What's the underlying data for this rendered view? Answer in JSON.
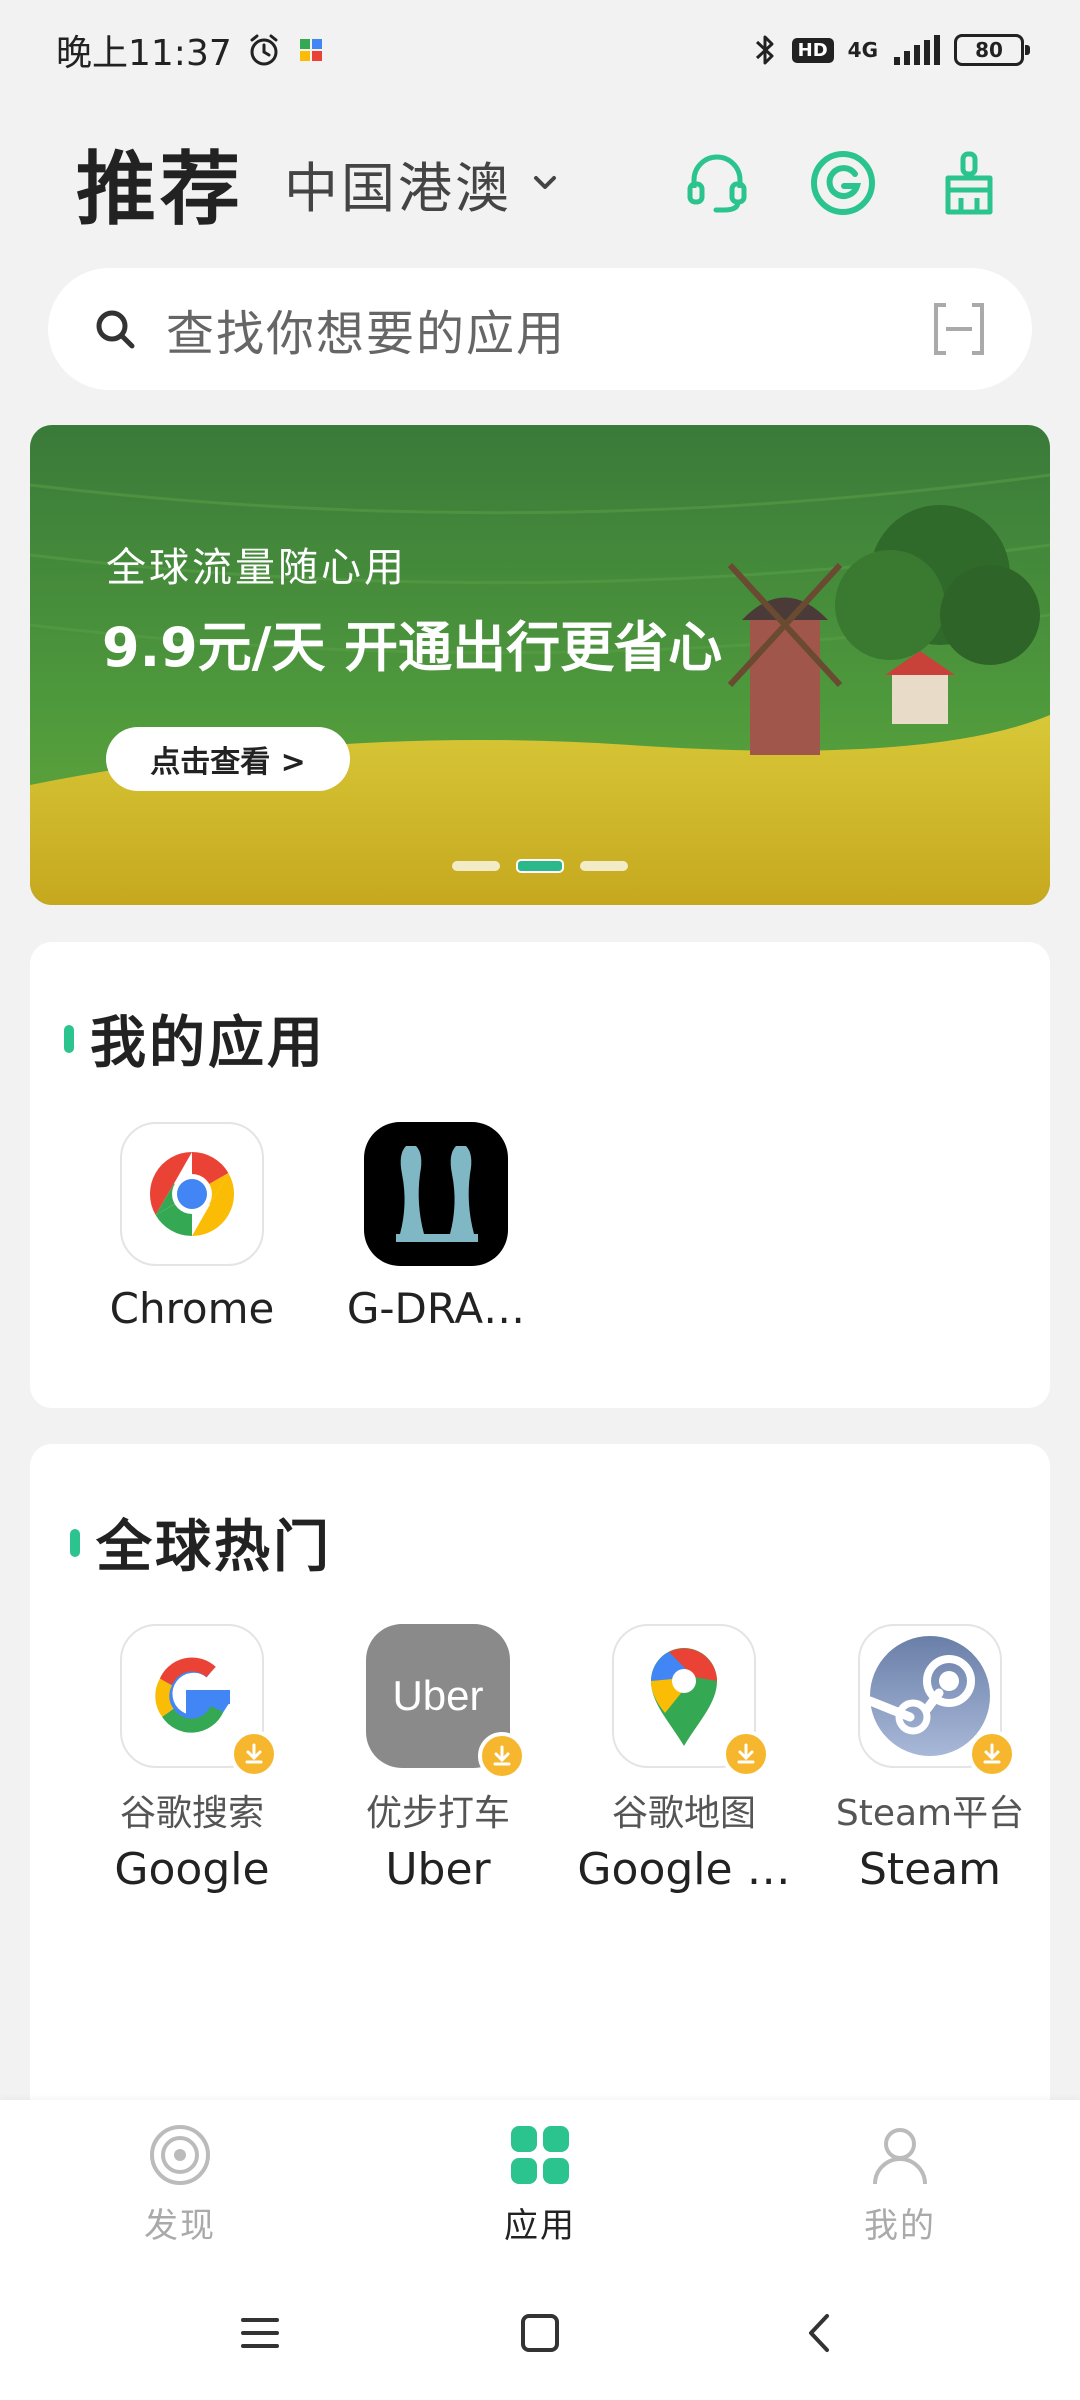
{
  "status_bar": {
    "time": "晚上11:37",
    "hd": "HD",
    "network": "4G",
    "battery": "80"
  },
  "header": {
    "title": "推荐",
    "region": "中国港澳"
  },
  "search": {
    "placeholder": "查找你想要的应用"
  },
  "banner": {
    "subtitle": "全球流量随心用",
    "title": "9.9元/天 开通出行更省心",
    "button": "点击查看 >",
    "slide_count": 3,
    "active_slide": 2
  },
  "my_apps": {
    "title": "我的应用",
    "items": [
      {
        "name": "Chrome",
        "icon": "chrome-icon"
      },
      {
        "name": "G-DRA…",
        "icon": "g-dragon-app-icon"
      }
    ]
  },
  "global_hot": {
    "title": "全球热门",
    "items": [
      {
        "cname": "谷歌搜索",
        "ename": "Google",
        "icon": "google-icon"
      },
      {
        "cname": "优步打车",
        "ename": "Uber",
        "icon": "uber-icon",
        "logo_text": "Uber"
      },
      {
        "cname": "谷歌地图",
        "ename": "Google …",
        "icon": "google-maps-icon"
      },
      {
        "cname": "Steam平台",
        "ename": "Steam",
        "icon": "steam-icon"
      }
    ]
  },
  "bottom_nav": {
    "items": [
      {
        "label": "发现",
        "icon": "discover-icon",
        "active": false
      },
      {
        "label": "应用",
        "icon": "apps-grid-icon",
        "active": true
      },
      {
        "label": "我的",
        "icon": "profile-icon",
        "active": false
      }
    ]
  },
  "colors": {
    "accent": "#2bc48f",
    "background": "#f2f2f2",
    "download_badge": "#f6b72e"
  }
}
